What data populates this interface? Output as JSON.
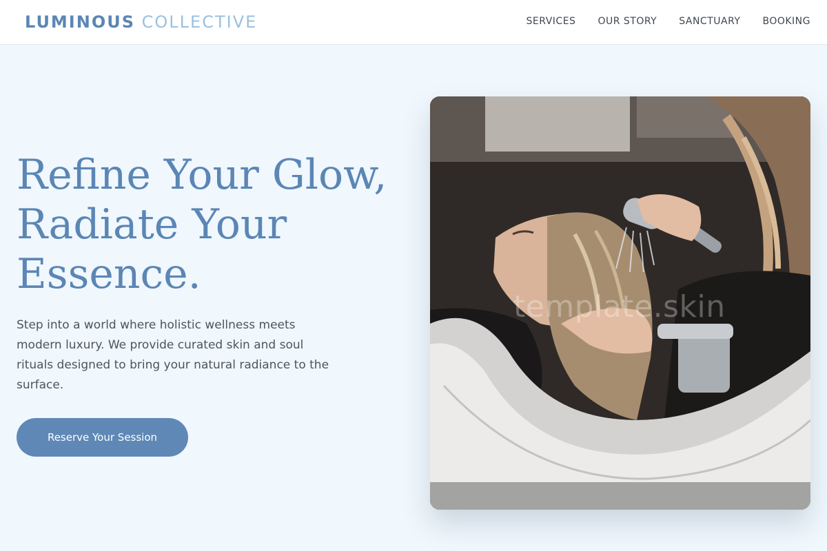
{
  "brand": {
    "primary": "LUMINOUS",
    "secondary": "COLLECTIVE"
  },
  "nav": [
    {
      "label": "SERVICES"
    },
    {
      "label": "OUR STORY"
    },
    {
      "label": "SANCTUARY"
    },
    {
      "label": "BOOKING"
    }
  ],
  "hero": {
    "title_line1": "Refine Your Glow,",
    "title_line2": "Radiate Your",
    "title_line3": "Essence.",
    "description": "Step into a world where holistic wellness meets modern luxury. We provide curated skin and soul rituals designed to bring your natural radiance to the surface.",
    "cta_label": "Reserve Your Session"
  },
  "image": {
    "watermark": "template.skin"
  },
  "colors": {
    "accent": "#5b86b5",
    "background": "#f0f7fd",
    "button": "#5f88b6"
  }
}
